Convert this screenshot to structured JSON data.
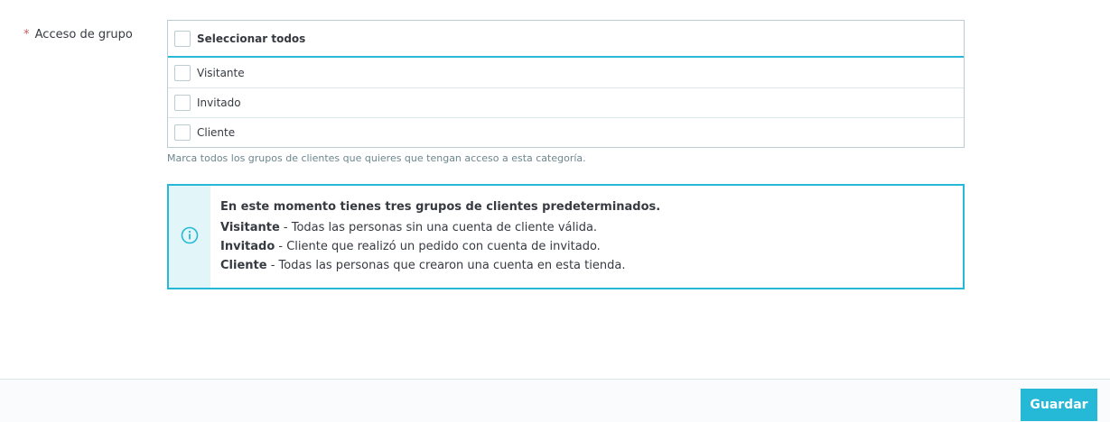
{
  "form": {
    "required_mark": "*",
    "label": "Acceso de grupo",
    "groups_header": "Seleccionar todos",
    "groups": [
      {
        "label": "Visitante",
        "checked": false
      },
      {
        "label": "Invitado",
        "checked": false
      },
      {
        "label": "Cliente",
        "checked": false
      }
    ],
    "help_text": "Marca todos los grupos de clientes que quieres que tengan acceso a esta categoría."
  },
  "info": {
    "icon": "info-circle-icon",
    "title": "En este momento tienes tres grupos de clientes predeterminados.",
    "lines": [
      {
        "term": "Visitante",
        "description": " - Todas las personas sin una cuenta de cliente válida."
      },
      {
        "term": "Invitado",
        "description": " - Cliente que realizó un pedido con cuenta de invitado."
      },
      {
        "term": "Cliente",
        "description": " - Todas las personas que crearon una cuenta en esta tienda."
      }
    ]
  },
  "footer": {
    "save_label": "Guardar"
  },
  "colors": {
    "accent": "#25b9d7",
    "required": "#c05c67",
    "text": "#363a41",
    "muted": "#6c868e"
  }
}
